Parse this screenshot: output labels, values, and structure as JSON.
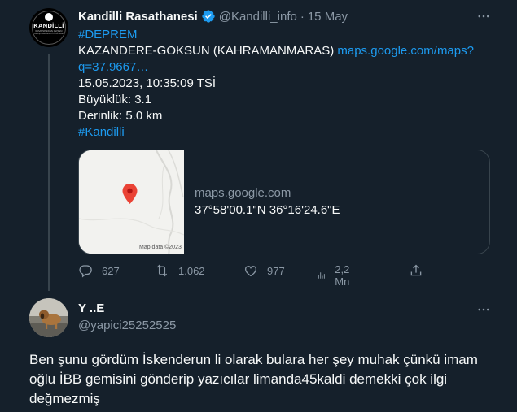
{
  "colors": {
    "background": "#15202b",
    "text": "#f7f9f9",
    "secondary_text": "#8b98a5",
    "link": "#1d9bf0",
    "border": "#38444d",
    "verified_badge": "#1d9bf0"
  },
  "tweet": {
    "author_name": "Kandilli Rasathanesi",
    "author_avatar_text": "KANDİLLİ",
    "author_avatar_subtext": "RASATHANESİ VE DEPREM ARAŞTIRMA ENSTİTÜSÜ 1868",
    "verified_icon": "verified-badge-icon",
    "handle": "@Kandilli_info",
    "separator": "·",
    "date": "15 May",
    "more_icon": "more-horizontal-icon",
    "lines": {
      "hashtag_deprem": "#DEPREM",
      "location": "KAZANDERE-GOKSUN (KAHRAMANMARAS)",
      "map_link_part1": "maps.google.com/maps?",
      "map_link_part2": "q=37.9667…",
      "datetime": "15.05.2023, 10:35:09 TSİ",
      "magnitude": "Büyüklük: 3.1",
      "depth": "Derinlik: 5.0 km",
      "hashtag_kandilli": "#Kandilli"
    },
    "card": {
      "domain": "maps.google.com",
      "title": "37°58'00.1\"N 36°16'24.6\"E",
      "map_credit": "Map data ©2023",
      "pin_icon": "map-pin-icon"
    },
    "actions": {
      "replies": {
        "icon": "reply-icon",
        "count": "627"
      },
      "retweets": {
        "icon": "retweet-icon",
        "count": "1.062"
      },
      "likes": {
        "icon": "like-icon",
        "count": "977"
      },
      "views": {
        "icon": "views-icon",
        "count": "2,2 Mn"
      },
      "share": {
        "icon": "share-icon"
      }
    }
  },
  "reply": {
    "author_name": "Y ..E",
    "handle": "@yapici25252525",
    "more_icon": "more-horizontal-icon",
    "text": "Ben şunu gördüm İskenderun li olarak bulara her şey muhak çünkü imam oğlu İBB gemisini gönderip yazıcılar limanda45kaldi demekki çok ilgi değmezmiş"
  }
}
